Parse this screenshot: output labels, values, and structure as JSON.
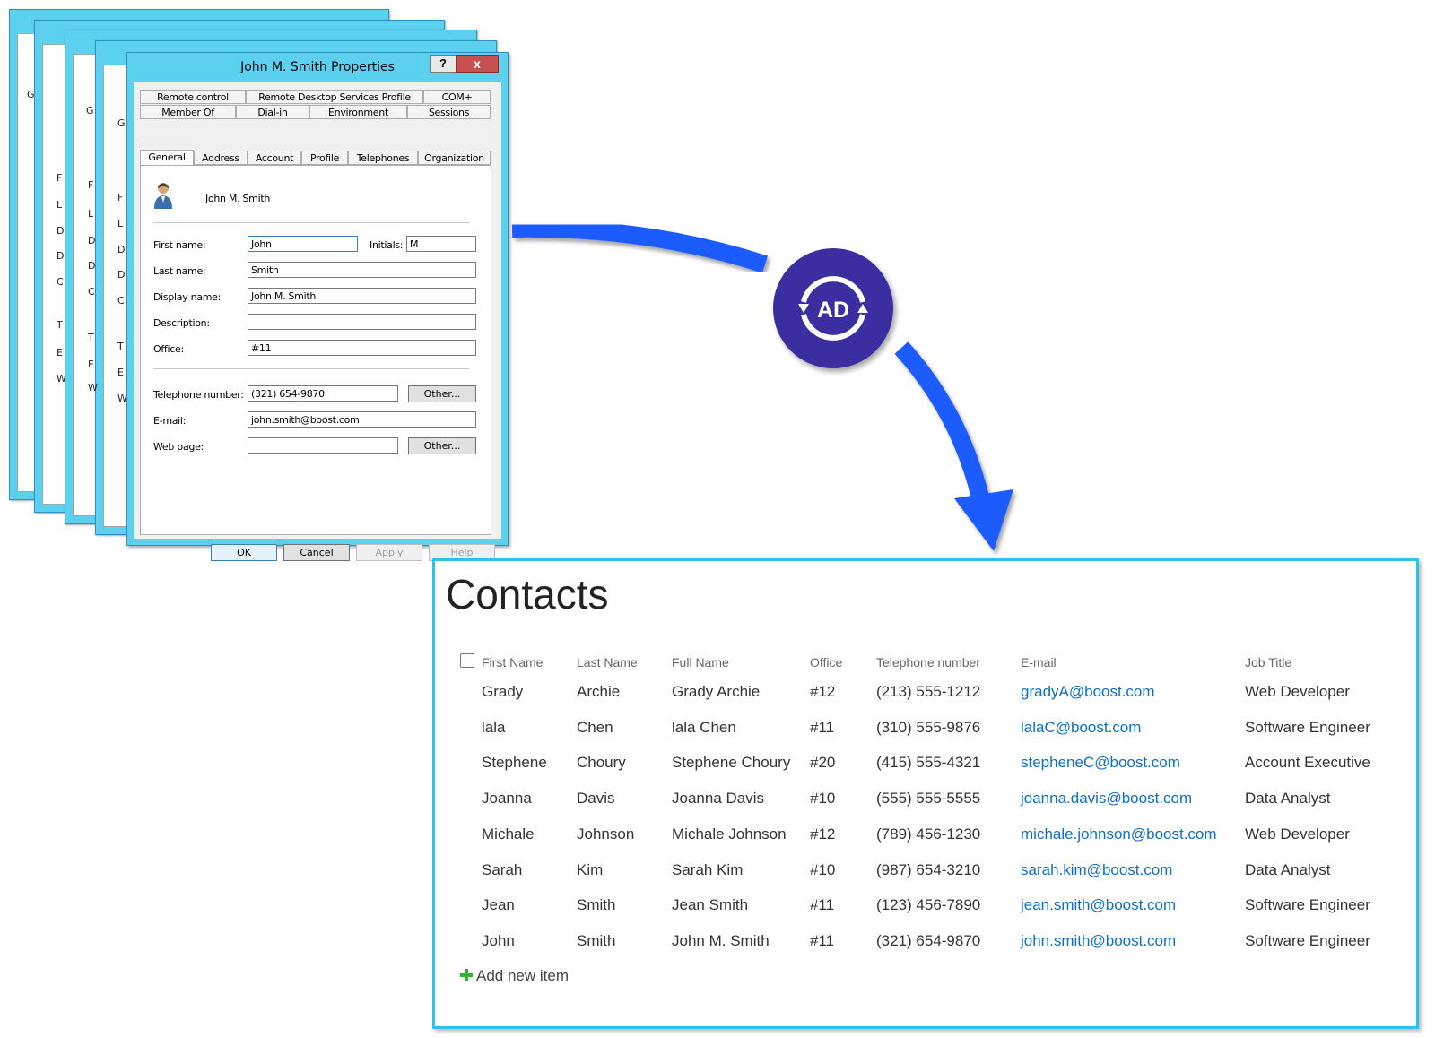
{
  "dialog": {
    "title": "John M. Smith Properties",
    "help_label": "?",
    "close_label": "x",
    "tabs_row1": [
      "Remote control",
      "Remote Desktop Services Profile",
      "COM+"
    ],
    "tabs_row2": [
      "Member Of",
      "Dial-in",
      "Environment",
      "Sessions"
    ],
    "tabs_row3": [
      "General",
      "Address",
      "Account",
      "Profile",
      "Telephones",
      "Organization"
    ],
    "display_header": "John M. Smith",
    "labels": {
      "first_name": "First name:",
      "initials": "Initials:",
      "last_name": "Last name:",
      "display_name": "Display name:",
      "description": "Description:",
      "office": "Office:",
      "telephone": "Telephone number:",
      "email": "E-mail:",
      "web_page": "Web page:"
    },
    "values": {
      "first_name": "John",
      "initials": "M",
      "last_name": "Smith",
      "display_name": "John M. Smith",
      "description": "",
      "office": "#11",
      "telephone": "(321) 654-9870",
      "email": "john.smith@boost.com",
      "web_page": ""
    },
    "other_label": "Other...",
    "buttons": {
      "ok": "OK",
      "cancel": "Cancel",
      "apply": "Apply",
      "help": "Help"
    }
  },
  "background_fragments": [
    "G",
    "F",
    "L",
    "D",
    "D",
    "C",
    "T",
    "E",
    "W"
  ],
  "ad_badge": {
    "text": "AD",
    "color": "#3a2ea0"
  },
  "arrow_color": "#1a5cff",
  "contacts": {
    "title": "Contacts",
    "columns": [
      "First Name",
      "Last Name",
      "Full Name",
      "Office",
      "Telephone number",
      "E-mail",
      "Job Title"
    ],
    "rows": [
      [
        "Grady",
        "Archie",
        "Grady Archie",
        "#12",
        "(213) 555-1212",
        "gradyA@boost.com",
        "Web Developer"
      ],
      [
        "lala",
        "Chen",
        "lala Chen",
        "#11",
        "(310) 555-9876",
        "lalaC@boost.com",
        "Software Engineer"
      ],
      [
        "Stephene",
        "Choury",
        "Stephene Choury",
        "#20",
        "(415) 555-4321",
        "stepheneC@boost.com",
        "Account Executive"
      ],
      [
        "Joanna",
        "Davis",
        "Joanna Davis",
        "#10",
        "(555) 555-5555",
        "joanna.davis@boost.com",
        "Data Analyst"
      ],
      [
        "Michale",
        "Johnson",
        "Michale Johnson",
        "#12",
        "(789) 456-1230",
        "michale.johnson@boost.com",
        "Web Developer"
      ],
      [
        "Sarah",
        "Kim",
        "Sarah Kim",
        "#10",
        "(987) 654-3210",
        "sarah.kim@boost.com",
        "Data Analyst"
      ],
      [
        "Jean",
        "Smith",
        "Jean Smith",
        "#11",
        "(123) 456-7890",
        "jean.smith@boost.com",
        "Software Engineer"
      ],
      [
        "John",
        "Smith",
        "John M. Smith",
        "#11",
        "(321) 654-9870",
        "john.smith@boost.com",
        "Software Engineer"
      ]
    ],
    "add_new_label": "Add new item"
  }
}
